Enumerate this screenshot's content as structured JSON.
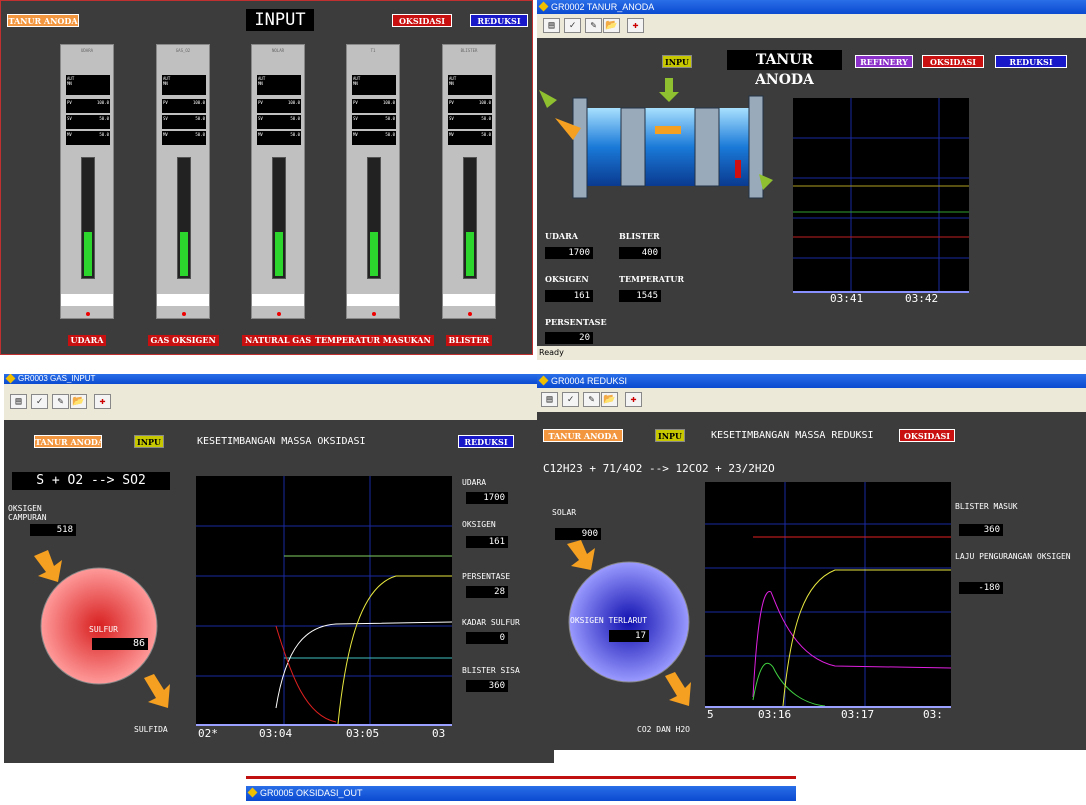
{
  "w1": {
    "btn_tanur": "TANUR ANODA",
    "title": "INPUT",
    "btn_oks": "OKSIDASI",
    "btn_red": "REDUKSI",
    "cols": [
      {
        "head": "UDARA",
        "tag": "UDARA",
        "level": 0.37
      },
      {
        "head": "GAS_O2",
        "tag": "GAS OKSIGEN",
        "level": 0.37
      },
      {
        "head": "NOLAR",
        "tag": "NATURAL GAS",
        "level": 0.37
      },
      {
        "head": "T1",
        "tag": "TEMPERATUR MASUKAN",
        "level": 0.37
      },
      {
        "head": "BLISTER",
        "tag": "BLISTER",
        "level": 0.37
      }
    ],
    "mini": {
      "aut": "AUT",
      "mn": "MN",
      "pv": "PV",
      "sv": "SV",
      "mv": "MV",
      "pv_val": "100.0",
      "sv_val": "50.0",
      "mv_val": "50.0"
    }
  },
  "w2": {
    "title": "GR0002 TANUR_ANODA",
    "btn_inpu": "INPU",
    "heading": "TANUR ANODA",
    "btn_ref": "REFINERY",
    "btn_oks": "OKSIDASI",
    "btn_red": "REDUKSI",
    "udara_lbl": "UDARA",
    "udara": "1700",
    "blister_lbl": "BLISTER",
    "blister": "400",
    "oksigen_lbl": "OKSIGEN",
    "oksigen": "161",
    "temp_lbl": "TEMPERATUR",
    "temp": "1545",
    "pers_lbl": "PERSENTASE",
    "pers": "20",
    "t1": "03:41",
    "t2": "03:42",
    "status": "Ready"
  },
  "w3": {
    "title": "GR0003 GAS_INPUT",
    "btn_tanur": "TANUR ANODA",
    "btn_inpu": "INPU",
    "heading": "KESETIMBANGAN MASSA OKSIDASI",
    "btn_red": "REDUKSI",
    "reaction": "S + O2 --> SO2",
    "oks_lbl": "OKSIGEN CAMPURAN",
    "oks": "518",
    "sulfur_lbl": "SULFUR",
    "sulfur": "86",
    "sulfida": "SULFIDA",
    "udara_lbl": "UDARA",
    "udara": "1700",
    "oksigen_lbl": "OKSIGEN",
    "oksigen": "161",
    "pers_lbl": "PERSENTASE",
    "pers": "28",
    "kadar_lbl": "KADAR SULFUR",
    "kadar": "0",
    "blister_lbl": "BLISTER SISA",
    "blister": "360",
    "t0": "02*",
    "t1": "03:04",
    "t2": "03:05",
    "t3": "03"
  },
  "w4": {
    "title": "GR0004 REDUKSI",
    "btn_tanur": "TANUR ANODA",
    "btn_inpu": "INPU",
    "heading": "KESETIMBANGAN MASSA REDUKSI",
    "btn_oks": "OKSIDASI",
    "reaction": "C12H23 + 71/4O2 --> 12CO2 + 23/2H2O",
    "solar_lbl": "SOLAR",
    "solar": "900",
    "terlarut_lbl": "OKSIGEN TERLARUT",
    "terlarut": "17",
    "co2": "CO2 DAN H2O",
    "blister_lbl": "BLISTER MASUK",
    "blister": "360",
    "laju_lbl": "LAJU PENGURANGAN OKSIGEN",
    "laju": "-180",
    "t0": "5",
    "t1": "03:16",
    "t2": "03:17",
    "t3": "03:"
  },
  "w5": {
    "title": "GR0005 OKSIDASI_OUT"
  },
  "colors": {
    "panel": "#3c3c3c",
    "titlebar": "#0a4ad0",
    "orange": "#f29640",
    "red": "#c81010",
    "blue": "#1818c8"
  }
}
